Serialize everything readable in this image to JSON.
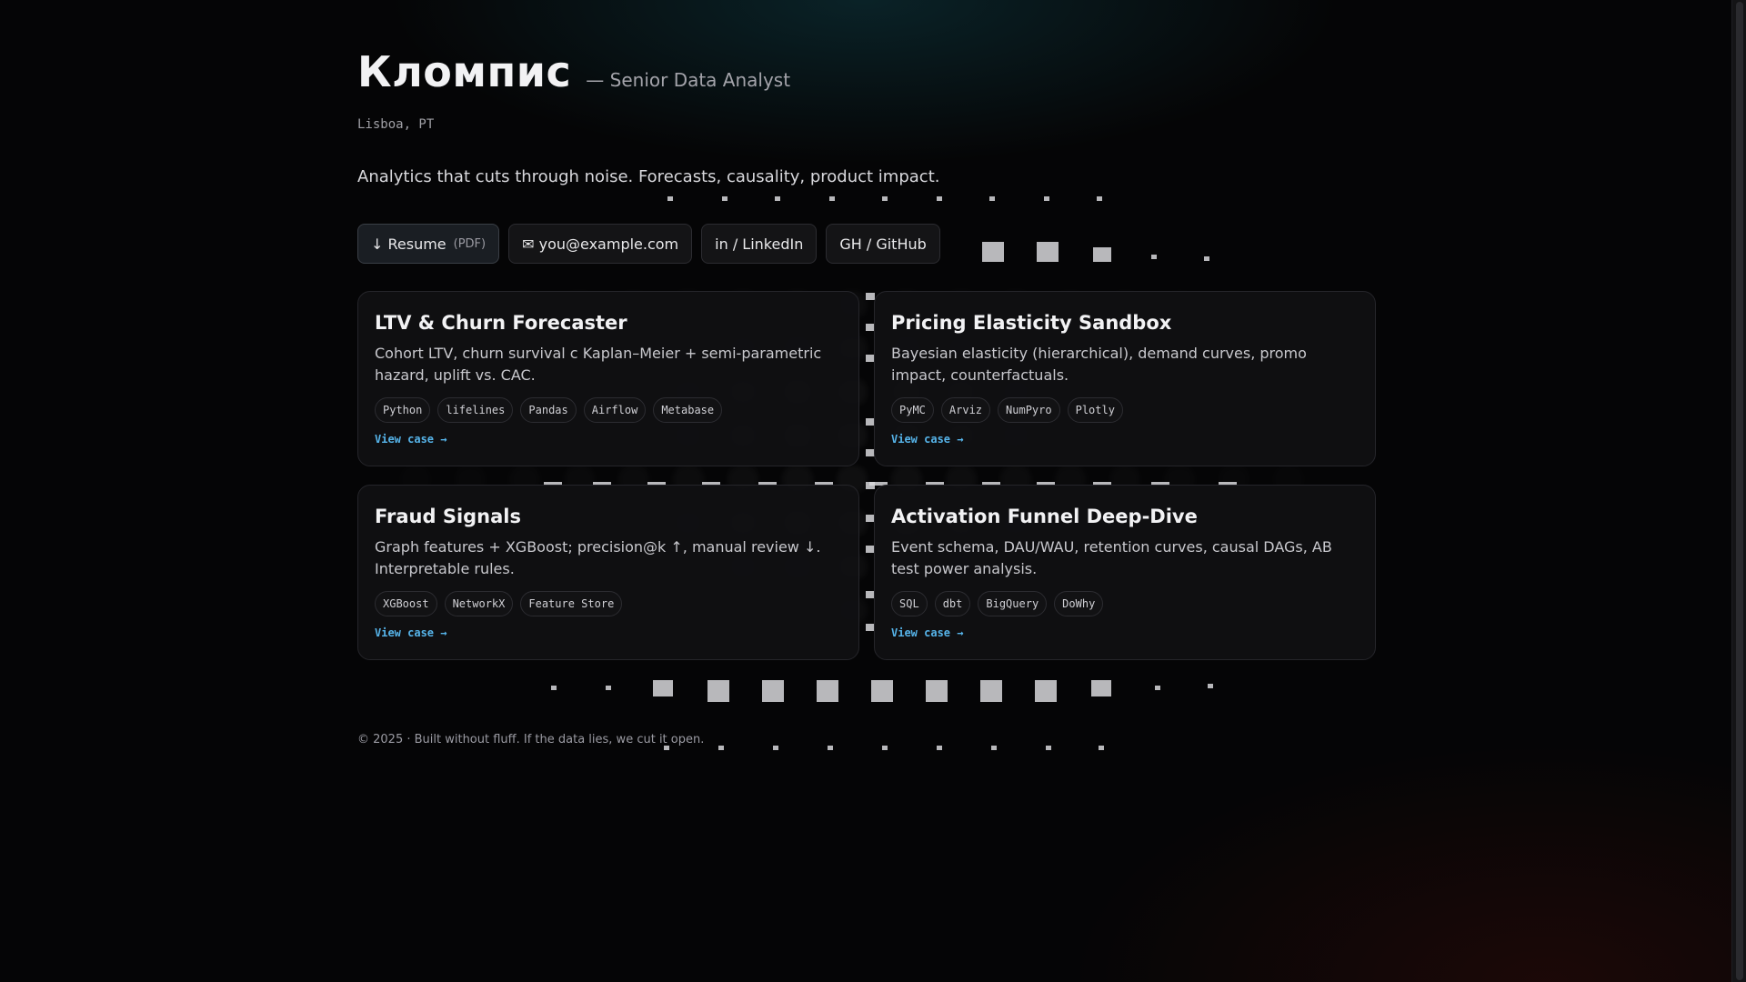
{
  "header": {
    "name": "Кломпис",
    "role": "— Senior Data Analyst",
    "location": "Lisboa, PT",
    "tagline": "Analytics that cuts through noise. Forecasts, causality, product impact."
  },
  "links": [
    {
      "icon": "download-icon",
      "label": "↓ Resume",
      "sub": "(PDF)"
    },
    {
      "icon": "mail-icon",
      "label": "✉ you@example.com"
    },
    {
      "icon": "linkedin-icon",
      "label": "in / LinkedIn"
    },
    {
      "icon": "github-icon",
      "label": "GH / GitHub"
    }
  ],
  "projects": [
    {
      "title": "LTV & Churn Forecaster",
      "description": "Cohort LTV, churn survival с Kaplan–Meier + semi-parametric hazard, uplift vs. CAC.",
      "tags": [
        "Python",
        "lifelines",
        "Pandas",
        "Airflow",
        "Metabase"
      ],
      "link": "View case →"
    },
    {
      "title": "Pricing Elasticity Sandbox",
      "description": "Bayesian elasticity (hierarchical), demand curves, promo impact, counterfactuals.",
      "tags": [
        "PyMC",
        "Arviz",
        "NumPyro",
        "Plotly"
      ],
      "link": "View case →"
    },
    {
      "title": "Fraud Signals",
      "description": "Graph features + XGBoost; precision@k ↑, manual review ↓. Interpretable rules.",
      "tags": [
        "XGBoost",
        "NetworkX",
        "Feature Store"
      ],
      "link": "View case →"
    },
    {
      "title": "Activation Funnel Deep-Dive",
      "description": "Event schema, DAU/WAU, retention curves, causal DAGs, AB test power analysis.",
      "tags": [
        "SQL",
        "dbt",
        "BigQuery",
        "DoWhy"
      ],
      "link": "View case →"
    }
  ],
  "footer": {
    "text": "© 2025 · Built without fluff. If the data lies, we cut it open."
  },
  "colors": {
    "background": "#050506",
    "accent_link": "#56b4ea",
    "card_bg": "#101012"
  }
}
